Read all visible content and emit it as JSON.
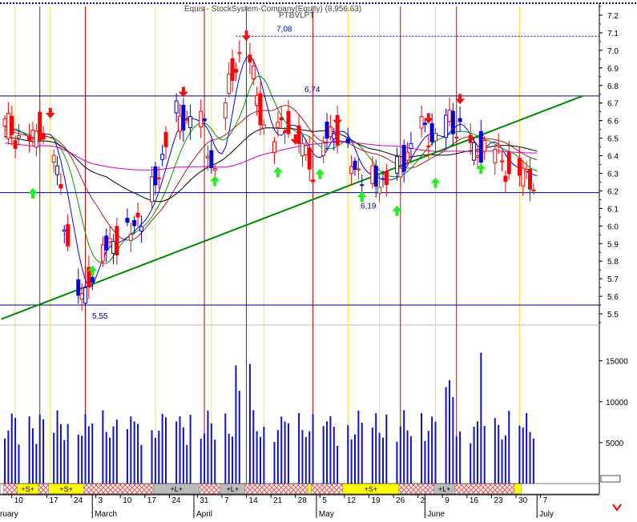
{
  "chart_data": {
    "type": "candlestick",
    "title": "Equis - StockSystem-Company(Equity) (8,956.63)",
    "subtitle": "PTBVLPT",
    "price_axis": {
      "ylim": [
        5.45,
        7.25
      ],
      "ticks": [
        "7.2",
        "7.1",
        "7.0",
        "6.9",
        "6.8",
        "6.7",
        "6.6",
        "6.5",
        "6.4",
        "6.3",
        "6.2",
        "6.1",
        "6.0",
        "5.9",
        "5.8",
        "5.7",
        "5.6",
        "5.5"
      ],
      "tick_values": [
        7.2,
        7.1,
        7.0,
        6.9,
        6.8,
        6.7,
        6.6,
        6.5,
        6.4,
        6.3,
        6.2,
        6.1,
        6.0,
        5.9,
        5.8,
        5.7,
        5.6,
        5.5
      ]
    },
    "volume_axis": {
      "ylim": [
        0,
        18000
      ],
      "ticks": [
        "15000",
        "10000",
        "5000"
      ],
      "tick_values": [
        15000,
        10000,
        5000
      ]
    },
    "x_ticks": [
      "10",
      "17",
      "24",
      "3",
      "10",
      "17",
      "24",
      "31",
      "7",
      "14",
      "21",
      "28",
      "5",
      "12",
      "19",
      "26",
      "2",
      "9",
      "16",
      "23",
      "30",
      "7"
    ],
    "x_tick_index": [
      2,
      12,
      19,
      26,
      33,
      40,
      47,
      55,
      62,
      69,
      76,
      83,
      90,
      97,
      104,
      111,
      118,
      125,
      132,
      139,
      146,
      153
    ],
    "months": [
      {
        "label": "February",
        "index": -6
      },
      {
        "label": "March",
        "index": 25
      },
      {
        "label": "April",
        "index": 54
      },
      {
        "label": "May",
        "index": 89
      },
      {
        "label": "June",
        "index": 120
      },
      {
        "label": "July",
        "index": 152
      }
    ],
    "hlines": [
      {
        "value": 7.08,
        "label": "7,08",
        "style": "dashed",
        "from_index": 66
      },
      {
        "value": 6.74,
        "label": "6,74",
        "style": "solid"
      },
      {
        "value": 6.19,
        "label": "6,19",
        "style": "solid"
      },
      {
        "value": 5.55,
        "label": "5,55",
        "style": "solid"
      }
    ],
    "trendline": {
      "from": [
        -1,
        5.47
      ],
      "to": [
        165,
        6.74
      ]
    },
    "red_vlines": [
      10,
      23,
      57,
      69,
      88,
      113,
      129
    ],
    "yellow_vlines": [
      3,
      13,
      43,
      59,
      74,
      98,
      107,
      123,
      147
    ],
    "buy_arrows": [
      [
        8,
        6.28
      ],
      [
        25,
        5.84
      ],
      [
        60,
        6.35
      ],
      [
        78,
        6.4
      ],
      [
        90,
        6.39
      ],
      [
        102,
        6.26
      ],
      [
        112,
        6.18
      ],
      [
        123,
        6.34
      ],
      [
        136,
        6.42
      ]
    ],
    "sell_arrows": [
      [
        13,
        6.59
      ],
      [
        51,
        6.71
      ],
      [
        69,
        7.03
      ],
      [
        83,
        6.44
      ],
      [
        95,
        6.55
      ],
      [
        121,
        6.56
      ],
      [
        130,
        6.67
      ]
    ],
    "signal_bands": [
      {
        "from": 0,
        "to": 4,
        "type": "hatch"
      },
      {
        "from": 4,
        "to": 10,
        "type": "yellow",
        "label": "+S+"
      },
      {
        "from": 10,
        "to": 13,
        "type": "hatch"
      },
      {
        "from": 13,
        "to": 23,
        "type": "yellow",
        "label": "+S+"
      },
      {
        "from": 23,
        "to": 43,
        "type": "hatch"
      },
      {
        "from": 43,
        "to": 56,
        "type": "gray",
        "label": "+L+"
      },
      {
        "from": 56,
        "to": 62,
        "type": "hatch"
      },
      {
        "from": 62,
        "to": 69,
        "type": "gray",
        "label": "+L+"
      },
      {
        "from": 69,
        "to": 87,
        "type": "hatch"
      },
      {
        "from": 87,
        "to": 88,
        "type": "yellow"
      },
      {
        "from": 88,
        "to": 97,
        "type": "hatch"
      },
      {
        "from": 97,
        "to": 113,
        "type": "yellow",
        "label": "+S+"
      },
      {
        "from": 113,
        "to": 123,
        "type": "hatch"
      },
      {
        "from": 123,
        "to": 129,
        "type": "gray",
        "label": "+L+"
      },
      {
        "from": 129,
        "to": 146,
        "type": "hatch"
      },
      {
        "from": 146,
        "to": 148,
        "type": "yellow"
      }
    ]
  }
}
